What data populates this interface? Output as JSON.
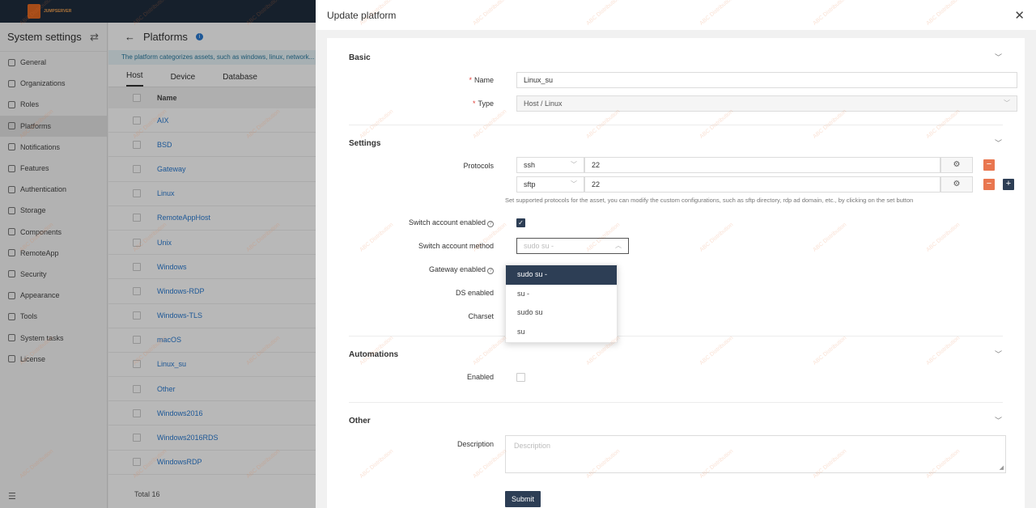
{
  "brand": {
    "logo_text": "JUMPSERVER"
  },
  "sidebar": {
    "title": "System settings",
    "items": [
      {
        "label": "General",
        "icon": "grid-icon"
      },
      {
        "label": "Organizations",
        "icon": "org-icon"
      },
      {
        "label": "Roles",
        "icon": "roles-icon"
      },
      {
        "label": "Platforms",
        "icon": "platform-icon",
        "active": true
      },
      {
        "label": "Notifications",
        "icon": "bell-icon"
      },
      {
        "label": "Features",
        "icon": "features-icon"
      },
      {
        "label": "Authentication",
        "icon": "auth-icon"
      },
      {
        "label": "Storage",
        "icon": "storage-icon"
      },
      {
        "label": "Components",
        "icon": "components-icon"
      },
      {
        "label": "RemoteApp",
        "icon": "remoteapp-icon"
      },
      {
        "label": "Security",
        "icon": "shield-icon"
      },
      {
        "label": "Appearance",
        "icon": "appearance-icon"
      },
      {
        "label": "Tools",
        "icon": "tools-icon"
      },
      {
        "label": "System tasks",
        "icon": "tasks-icon"
      },
      {
        "label": "License",
        "icon": "license-icon"
      }
    ]
  },
  "main": {
    "title": "Platforms",
    "banner": "The platform categorizes assets, such as windows, linux, network...",
    "tabs": [
      "Host",
      "Device",
      "Database"
    ],
    "column_name": "Name",
    "rows": [
      "AIX",
      "BSD",
      "Gateway",
      "Linux",
      "RemoteAppHost",
      "Unix",
      "Windows",
      "Windows-RDP",
      "Windows-TLS",
      "macOS",
      "Linux_su",
      "Other",
      "Windows2016",
      "Windows2016RDS",
      "WindowsRDP"
    ],
    "total": "Total 16"
  },
  "drawer": {
    "title": "Update platform",
    "sections": {
      "basic": "Basic",
      "settings": "Settings",
      "automations": "Automations",
      "other": "Other"
    },
    "fields": {
      "name_label": "Name",
      "name_value": "Linux_su",
      "type_label": "Type",
      "type_value": "Host / Linux",
      "protocols_label": "Protocols",
      "protocols": [
        {
          "name": "ssh",
          "port": "22"
        },
        {
          "name": "sftp",
          "port": "22"
        }
      ],
      "protocols_help": "Set supported protocols for the asset, you can modify the custom configurations, such as sftp directory, rdp ad domain, etc., by clicking on the set button",
      "switch_enabled_label": "Switch account enabled",
      "switch_method_label": "Switch account method",
      "switch_method_placeholder": "sudo su -",
      "gateway_enabled_label": "Gateway enabled",
      "ds_enabled_label": "DS enabled",
      "charset_label": "Charset",
      "automations_enabled_label": "Enabled",
      "description_label": "Description",
      "description_placeholder": "Description"
    },
    "dropdown_options": [
      "sudo su -",
      "su -",
      "sudo su",
      "su"
    ],
    "submit_label": "Submit"
  },
  "watermark": "ABC Distribution"
}
